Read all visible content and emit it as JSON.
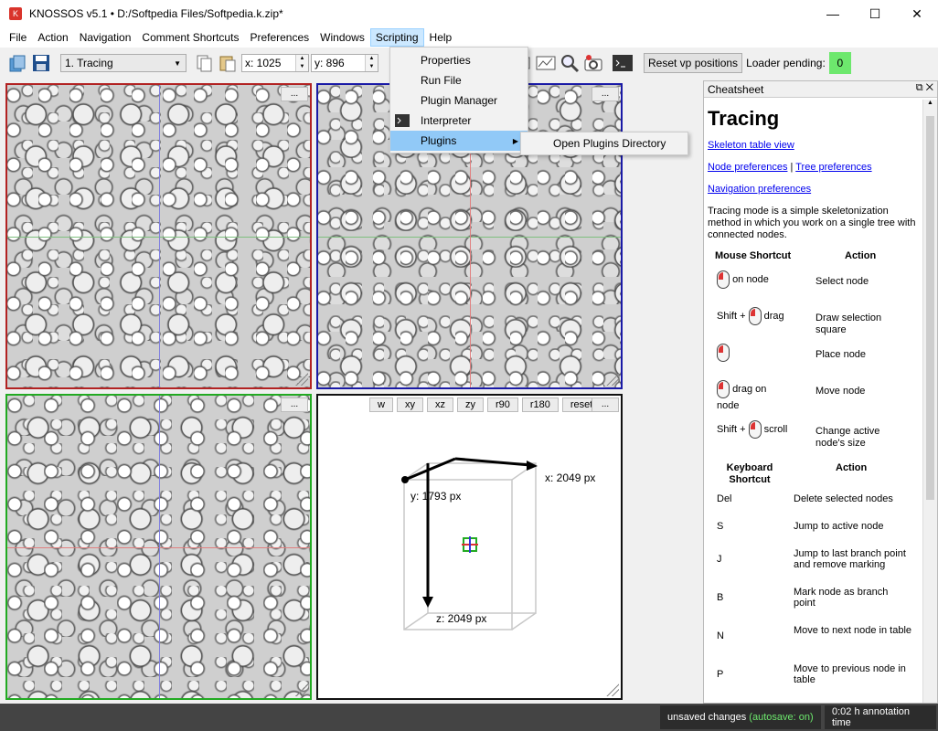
{
  "window": {
    "title": "KNOSSOS v5.1 • D:/Softpedia Files/Softpedia.k.zip*",
    "minimize": "—",
    "maximize": "☐",
    "close": "✕"
  },
  "menubar": [
    "File",
    "Action",
    "Navigation",
    "Comment Shortcuts",
    "Preferences",
    "Windows",
    "Scripting",
    "Help"
  ],
  "toolbar": {
    "mode_select": "1. Tracing",
    "x_field": "x: 1025",
    "y_field": "y: 896",
    "reset_vp_label": "Reset vp positions",
    "loader_label": "Loader pending:",
    "loader_count": "0"
  },
  "scripting_menu": {
    "items": [
      "Properties",
      "Run File",
      "Plugin Manager",
      "Interpreter",
      "Plugins"
    ],
    "plugins_submenu": "Open Plugins Directory"
  },
  "viewports": {
    "dots": "...",
    "vp3d_buttons": [
      "w",
      "xy",
      "xz",
      "zy",
      "r90",
      "r180",
      "reset"
    ],
    "x_label": "x: 2049 px",
    "y_label": "y: 1793 px",
    "z_label": "z: 2049 px",
    "colors": {
      "xy": "#b22222",
      "xz": "#22aa22",
      "zy": "#1a1aa6"
    }
  },
  "cheatsheet": {
    "dock_title": "Cheatsheet",
    "heading": "Tracing",
    "links": [
      "Skeleton table view",
      "Node preferences",
      "Tree preferences",
      "Navigation preferences"
    ],
    "link_separator": "|",
    "description": "Tracing mode is a simple skeletonization method in which you work on a single tree with connected nodes.",
    "mouse_header": [
      "Mouse Shortcut",
      "Action"
    ],
    "mouse_rows": [
      {
        "shortcut": "on node",
        "action": "Select node"
      },
      {
        "shortcut": "Shift + ",
        "suffix": "drag",
        "action": "Draw selection square"
      },
      {
        "shortcut": "",
        "action": "Place node"
      },
      {
        "shortcut": "drag on node",
        "action": "Move node"
      },
      {
        "shortcut": "Shift + ",
        "suffix": "scroll",
        "action": "Change active node's size"
      }
    ],
    "kb_header": [
      "Keyboard Shortcut",
      "Action"
    ],
    "kb_rows": [
      {
        "key": "Del",
        "action": "Delete selected nodes"
      },
      {
        "key": "S",
        "action": "Jump to active node"
      },
      {
        "key": "J",
        "action": "Jump to last branch point and remove marking"
      },
      {
        "key": "B",
        "action": "Mark node as branch point"
      },
      {
        "key": "N",
        "action": "Move to next node in table"
      },
      {
        "key": "P",
        "action": "Move to previous node in table"
      }
    ]
  },
  "status": {
    "unsaved": "unsaved changes",
    "autosave": "(autosave: on)",
    "time": "0:02 h annotation time"
  }
}
